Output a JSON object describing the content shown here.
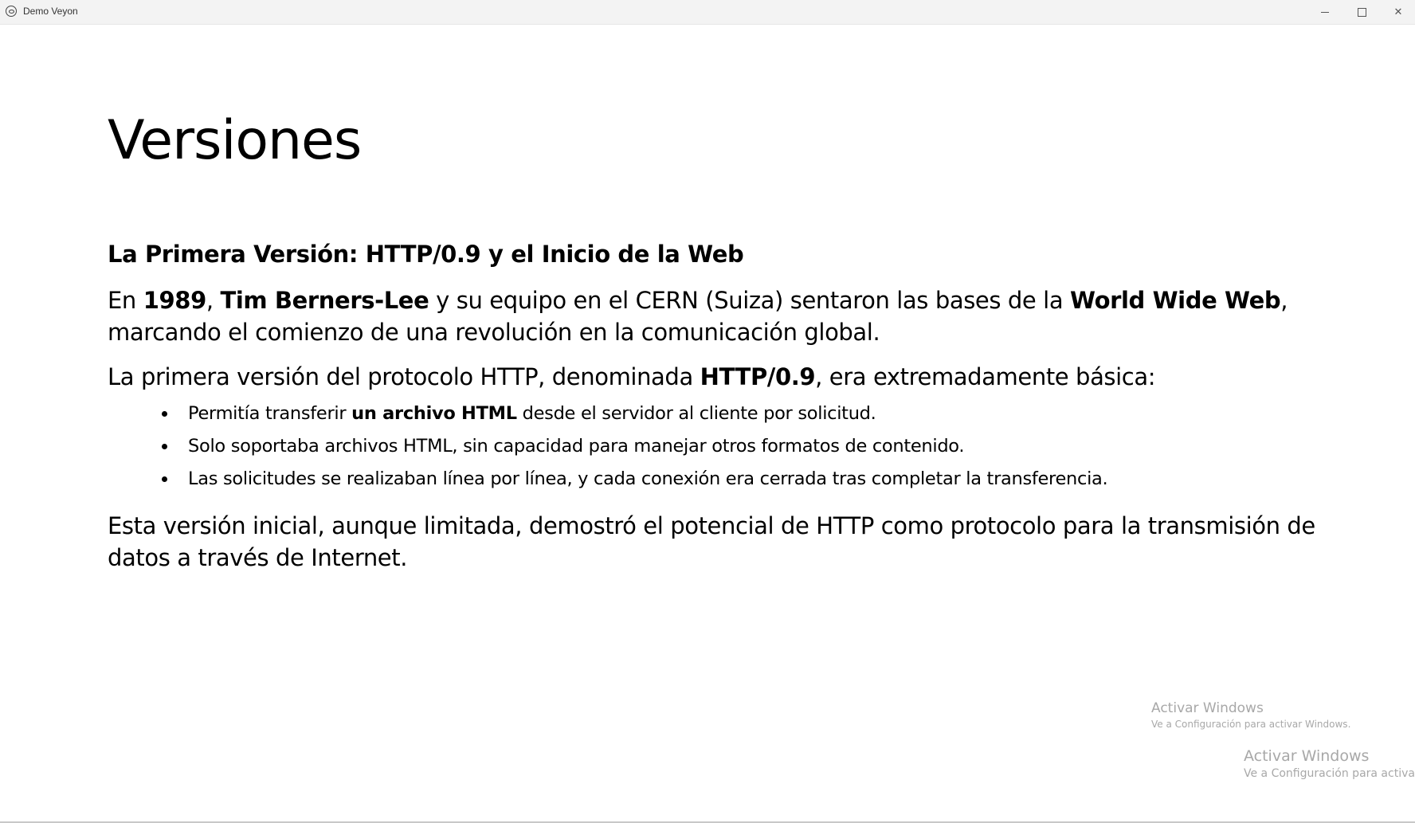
{
  "window": {
    "title": "Demo Veyon",
    "controls": {
      "minimize_icon": "minimize-icon",
      "maximize_icon": "maximize-icon",
      "close_label": "✕"
    }
  },
  "slide": {
    "title": "Versiones",
    "subheading": "La Primera Versión: HTTP/0.9 y el Inicio de la Web",
    "para1": {
      "t1": "En ",
      "b1": "1989",
      "t2": ", ",
      "b2": "Tim Berners-Lee",
      "t3": " y su equipo en el CERN (Suiza) sentaron las bases de la ",
      "b3": "World Wide Web",
      "t4": ", marcando el comienzo de una revolución en la comunicación global."
    },
    "para2": {
      "t1": "La primera versión del protocolo HTTP, denominada ",
      "b1": "HTTP/0.9",
      "t2": ", era extremadamente básica:"
    },
    "bullets": [
      {
        "t1": "Permitía transferir ",
        "b1": "un archivo HTML",
        "t2": " desde el servidor al cliente por solicitud."
      },
      {
        "t1": "Solo soportaba archivos HTML, sin capacidad para manejar otros formatos de contenido."
      },
      {
        "t1": "Las solicitudes se realizaban línea por línea, y cada conexión era cerrada tras completar la transferencia."
      }
    ],
    "para3": "Esta versión inicial, aunque limitada, demostró el potencial de HTTP como protocolo para la transmisión de datos a través de Internet."
  },
  "watermarks": [
    {
      "title": "Activar Windows",
      "subtitle": "Ve a Configuración para activar Windows."
    },
    {
      "title": "Activar Windows",
      "subtitle": "Ve a Configuración para activar V"
    }
  ]
}
